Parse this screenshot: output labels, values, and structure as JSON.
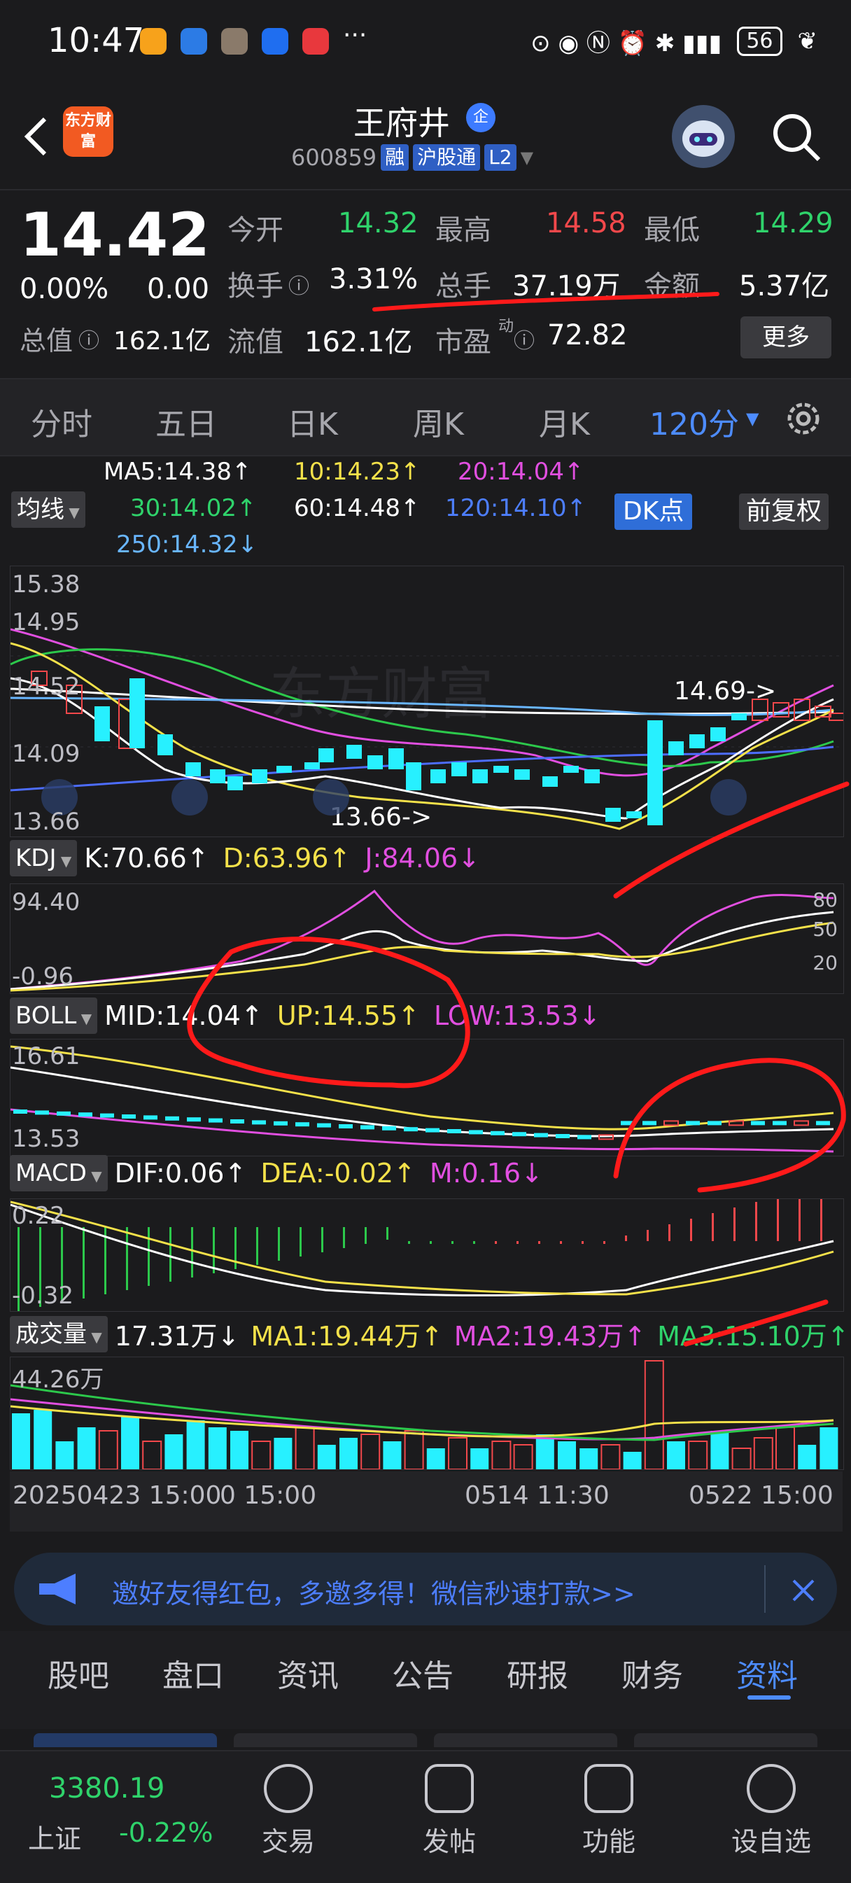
{
  "status": {
    "time": "10:47",
    "battery": "56",
    "more_icons": "···"
  },
  "header": {
    "brand_logo": "东方财富",
    "stock_name": "王府井",
    "badge": "企",
    "code": "600859",
    "tags": [
      "融",
      "沪股通",
      "L2"
    ]
  },
  "quote": {
    "price": "14.42",
    "change_pct": "0.00%",
    "change_amt": "0.00",
    "open_label": "今开",
    "open": "14.32",
    "high_label": "最高",
    "high": "14.58",
    "low_label": "最低",
    "low": "14.29",
    "turnover_label": "换手",
    "turnover": "3.31%",
    "volume_label": "总手",
    "volume": "37.19万",
    "amount_label": "金额",
    "amount": "5.37亿",
    "mktcap_label": "总值",
    "mktcap": "162.1亿",
    "float_label": "流值",
    "float_cap": "162.1亿",
    "pe_label": "市盈",
    "pe_sup": "动",
    "pe": "72.82",
    "more_btn": "更多"
  },
  "period_tabs": {
    "items": [
      "分时",
      "五日",
      "日K",
      "周K",
      "月K",
      "120分"
    ],
    "active": "120分"
  },
  "ma_legend": {
    "toggle": "均线",
    "ma5": "MA5:14.38↑",
    "ma10": "10:14.23↑",
    "ma20": "20:14.04↑",
    "ma30": "30:14.02↑",
    "ma60": "60:14.48↑",
    "ma120": "120:14.10↑",
    "ma250": "250:14.32↓",
    "dk_btn": "DK点",
    "fq_btn": "前复权"
  },
  "kline": {
    "y_top": "15.38",
    "y_mid": "14.95",
    "y_a": "14.52",
    "y_b": "14.09",
    "y_bottom": "13.66",
    "high_marker": "14.69->",
    "low_marker": "13.66->",
    "watermark": "东方财富"
  },
  "kdj": {
    "toggle": "KDJ",
    "k": "K:70.66↑",
    "d": "D:63.96↑",
    "j": "J:84.06↓",
    "y_top": "94.40",
    "y_bottom": "-0.96",
    "r80": "80",
    "r50": "50",
    "r20": "20"
  },
  "boll": {
    "toggle": "BOLL",
    "mid": "MID:14.04↑",
    "up": "UP:14.55↑",
    "low": "LOW:13.53↓",
    "y_top": "16.61",
    "y_bottom": "13.53"
  },
  "macd": {
    "toggle": "MACD",
    "dif": "DIF:0.06↑",
    "dea": "DEA:-0.02↑",
    "m": "M:0.16↓",
    "y_top": "0.22",
    "y_bottom": "-0.32"
  },
  "volume": {
    "toggle": "成交量",
    "vol": "17.31万↓",
    "ma1": "MA1:19.44万↑",
    "ma2": "MA2:19.43万↑",
    "ma3": "MA3:15.10万↑",
    "y_top": "44.26万",
    "x_start": "20250423 15:00",
    "x_start2": "0 15:00",
    "x_mid": "0514 11:30",
    "x_end": "0522 15:00"
  },
  "banner": {
    "text": "邀好友得红包，多邀多得！微信秒速打款>>"
  },
  "info_tabs": {
    "items": [
      "股吧",
      "盘口",
      "资讯",
      "公告",
      "研报",
      "财务",
      "资料"
    ],
    "active": "资料"
  },
  "index_bar": {
    "value": "3380.19",
    "name": "上证",
    "change": "-0.22%"
  },
  "nav": {
    "trade": "交易",
    "post": "发帖",
    "func": "功能",
    "watch": "设自选"
  },
  "colors": {
    "bg": "#1b1b1d",
    "up": "#f2484b",
    "down": "#27f0ff",
    "accent": "#4d7eff"
  }
}
